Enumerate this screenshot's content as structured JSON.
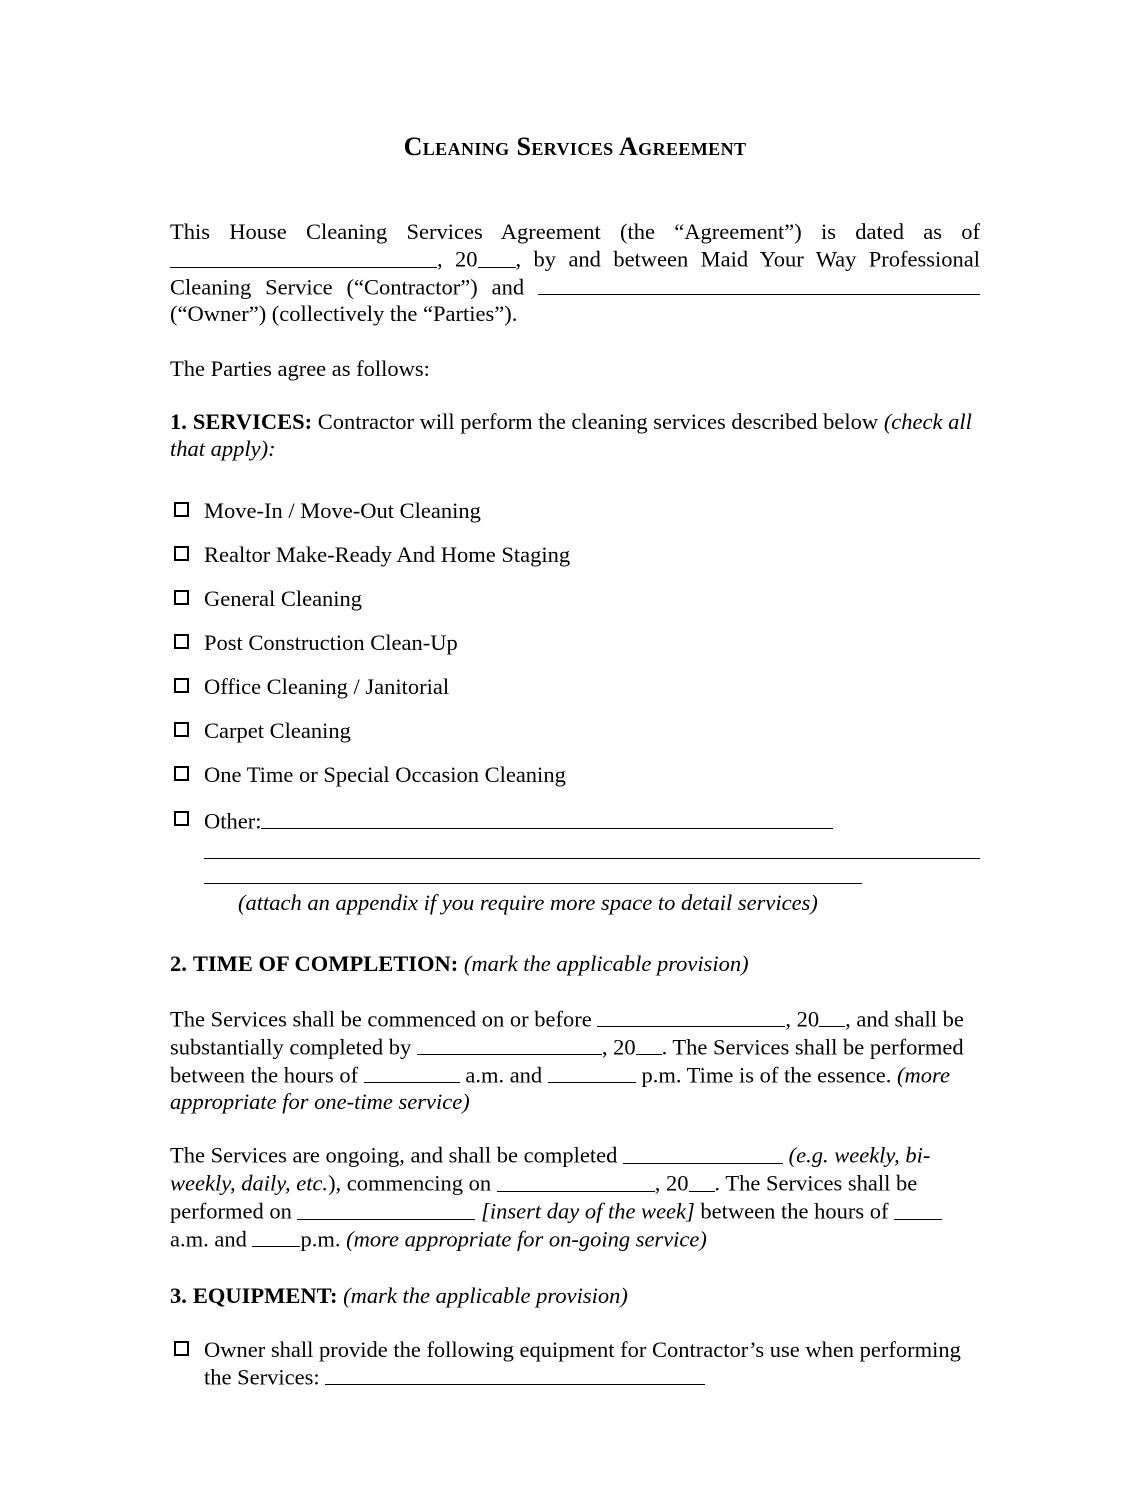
{
  "document": {
    "title": "Cleaning Services Agreement"
  },
  "intro": {
    "p1_a": "This House Cleaning Services Agreement (the “Agreement”) is dated as of",
    "p1_b": ", 20",
    "p1_c": ", by and between Maid Your Way Professional Cleaning Service (“Contractor”) and",
    "p1_d": "(“Owner”) (collectively the “Parties”).",
    "agree_line": "The Parties agree as follows:"
  },
  "section1": {
    "number": "1.",
    "name": "SERVICES:",
    "body": "Contractor will perform the cleaning services described below",
    "note": "(check all that apply):",
    "checklist": [
      "Move-In / Move-Out Cleaning",
      "Realtor Make-Ready And Home Staging",
      "General Cleaning",
      "Post Construction Clean-Up",
      "Office Cleaning / Janitorial",
      "Carpet Cleaning",
      "One Time or Special Occasion Cleaning"
    ],
    "other_label": "Other:",
    "appendix_note": "(attach an appendix if you require more space to detail services)"
  },
  "section2": {
    "number": "2.",
    "name": "TIME OF COMPLETION:",
    "note": "(mark the applicable provision)",
    "p1_a": "The Services shall be commenced on or before",
    "p1_b": ", 20",
    "p1_c": ", and shall be substantially completed by",
    "p1_d": ", 20",
    "p1_e": ".  The Services shall be performed between the hours of",
    "p1_f": "a.m. and",
    "p1_g": "p.m. Time is of the essence.",
    "p1_note": "(more appropriate for one-time service)",
    "p2_a": "The Services are ongoing, and shall be completed",
    "p2_note1": "(e.g. weekly, bi-weekly, daily, etc.",
    "p2_b": "), commencing on",
    "p2_c": ", 20",
    "p2_d": ".  The Services shall be performed on",
    "p2_note2": "[insert day of the week]",
    "p2_e": "between the hours of",
    "p2_f": "a.m. and",
    "p2_g": "p.m.",
    "p2_note3": "(more appropriate for on-going service)"
  },
  "section3": {
    "number": "3.",
    "name": "EQUIPMENT:",
    "note": "(mark the applicable provision)",
    "item_a": "Owner shall provide the following equipment for Contractor’s use when performing",
    "item_b": "the Services:"
  },
  "colors": {
    "text": "#000000",
    "page_background": "#ffffff",
    "rule": "#000000"
  }
}
